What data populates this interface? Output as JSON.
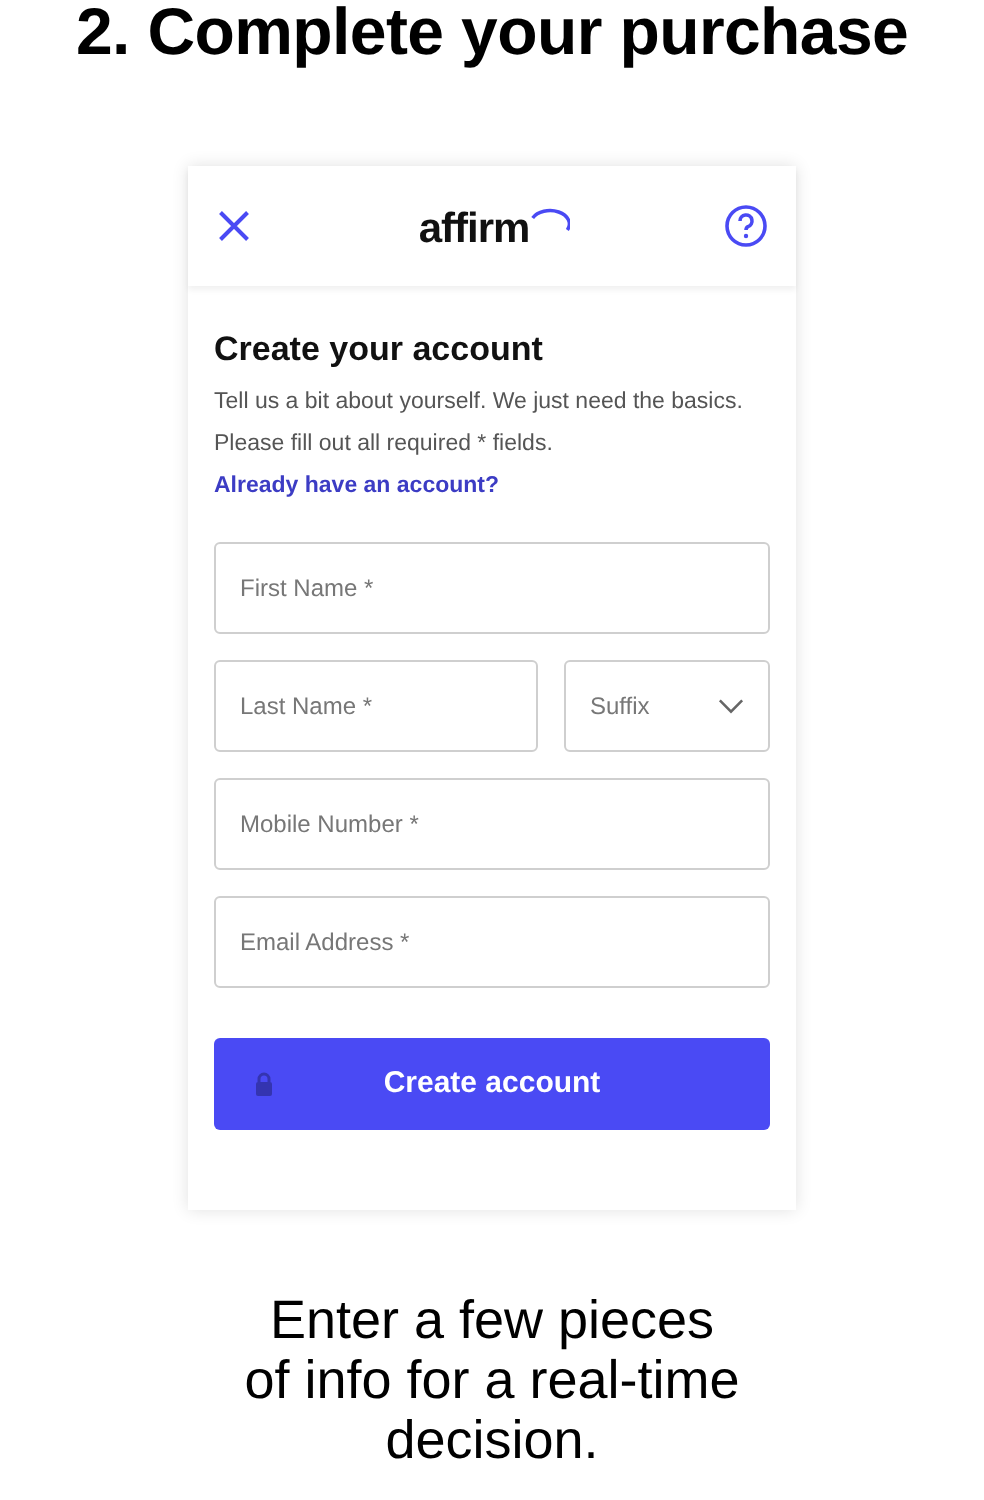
{
  "heading": "2. Complete your purchase",
  "header": {
    "logo": "affirm"
  },
  "form": {
    "title": "Create your account",
    "intro": "Tell us a bit about yourself. We just need the basics. Please fill out all required * fields.",
    "login_link": "Already have an account?",
    "fields": [
      {
        "kind": "text",
        "placeholder": "First Name *"
      },
      {
        "kind": "text",
        "placeholder": "Last Name *"
      },
      {
        "kind": "select",
        "placeholder": "Suffix"
      },
      {
        "kind": "text",
        "placeholder": "Mobile Number *"
      },
      {
        "kind": "text",
        "placeholder": "Email Address *"
      }
    ],
    "submit": "Create account"
  },
  "caption": "Enter a few pieces of info for a real-time decision."
}
